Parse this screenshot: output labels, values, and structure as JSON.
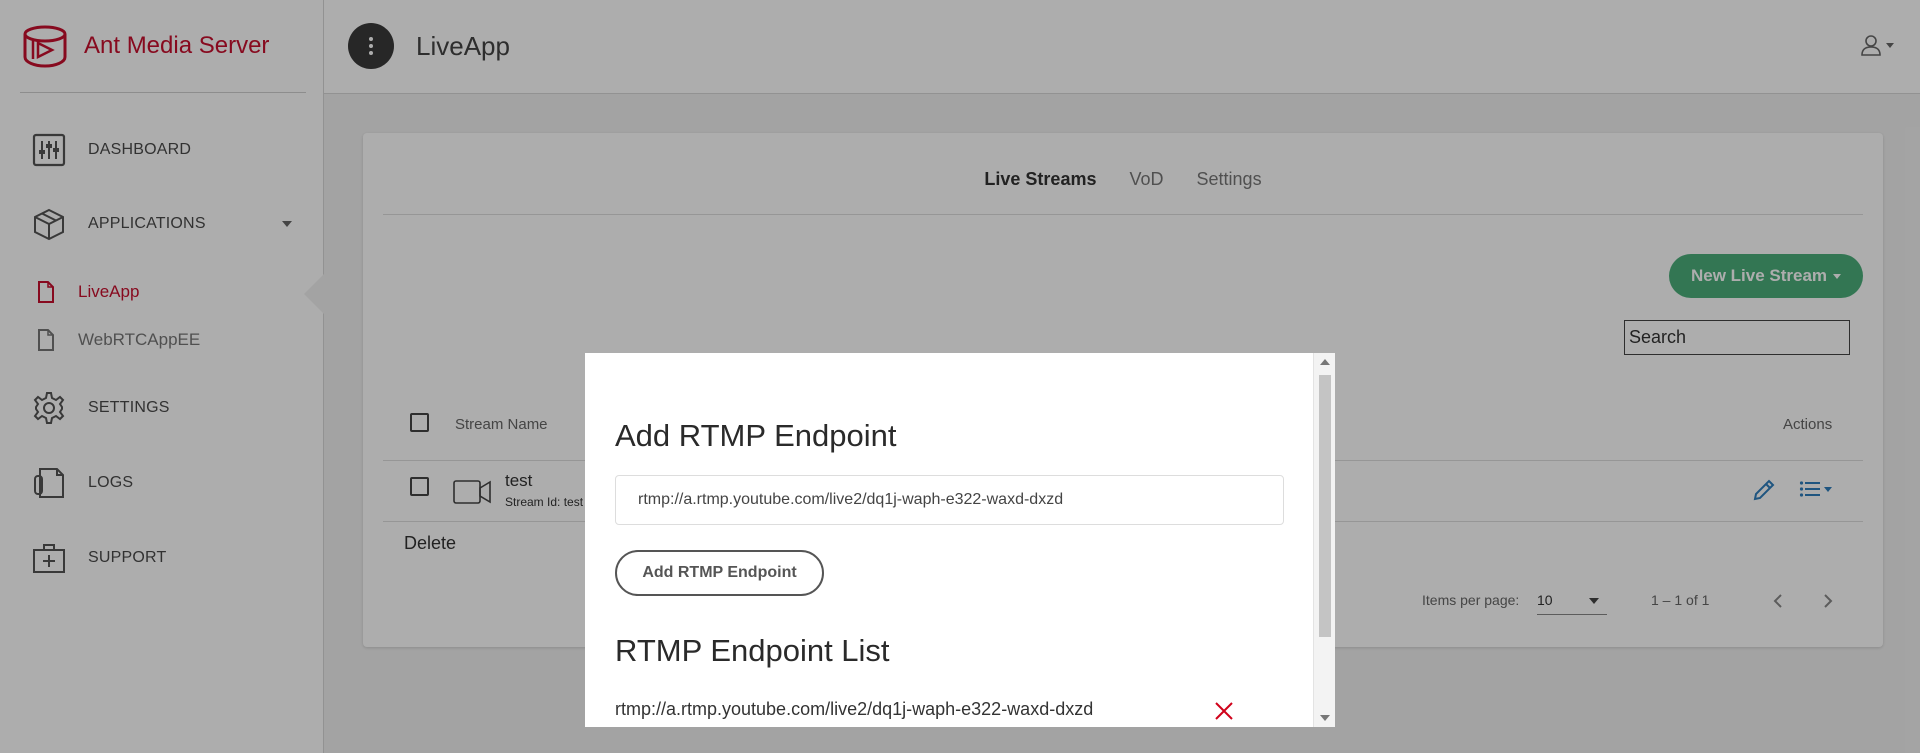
{
  "brand": {
    "name": "Ant Media Server",
    "color": "#c8102e"
  },
  "sidebar": {
    "items": [
      {
        "label": "DASHBOARD",
        "icon": "dashboard-sliders-icon"
      },
      {
        "label": "APPLICATIONS",
        "icon": "cube-icon"
      },
      {
        "label": "SETTINGS",
        "icon": "gear-icon"
      },
      {
        "label": "LOGS",
        "icon": "logs-icon"
      },
      {
        "label": "SUPPORT",
        "icon": "medical-kit-icon"
      }
    ],
    "apps": [
      {
        "label": "LiveApp",
        "active": true
      },
      {
        "label": "WebRTCAppEE",
        "active": false
      }
    ]
  },
  "header": {
    "title": "LiveApp"
  },
  "main": {
    "tabs": [
      {
        "label": "Live Streams",
        "active": true
      },
      {
        "label": "VoD",
        "active": false
      },
      {
        "label": "Settings",
        "active": false
      }
    ],
    "new_stream_label": "New Live Stream",
    "search": {
      "placeholder": "Search",
      "value": ""
    },
    "table": {
      "headers": {
        "name": "Stream Name",
        "actions": "Actions"
      },
      "rows": [
        {
          "name": "test",
          "stream_id": "Stream Id: test"
        }
      ]
    },
    "delete_label": "Delete",
    "pagination": {
      "items_per_page_label": "Items per page:",
      "items_per_page": "10",
      "range": "1 – 1 of 1"
    },
    "accent_color": "#4caf7b"
  },
  "modal": {
    "title": "Add RTMP Endpoint",
    "input_value": "rtmp://a.rtmp.youtube.com/live2/dq1j-waph-e322-waxd-dxzd",
    "add_button_label": "Add RTMP Endpoint",
    "list_title": "RTMP Endpoint List",
    "endpoints": [
      "rtmp://a.rtmp.youtube.com/live2/dq1j-waph-e322-waxd-dxzd"
    ]
  }
}
